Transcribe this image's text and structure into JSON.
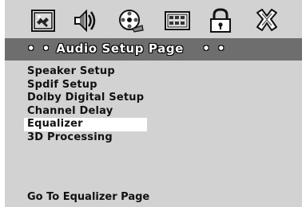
{
  "toolbar": {
    "icons": [
      "general-setup-icon",
      "audio-setup-icon",
      "video-setup-icon",
      "preference-icon",
      "password-lock-icon",
      "exit-icon"
    ]
  },
  "header": {
    "prefix": "• •",
    "title": "Audio Setup Page",
    "suffix": "• •"
  },
  "menu": {
    "items": [
      {
        "label": "Speaker Setup"
      },
      {
        "label": "Spdif Setup"
      },
      {
        "label": "Dolby Digital Setup"
      },
      {
        "label": "Channel Delay"
      },
      {
        "label": "Equalizer"
      },
      {
        "label": "3D Processing"
      }
    ],
    "selected": "Equalizer"
  },
  "footer": {
    "hint": "Go To Equalizer Page"
  }
}
